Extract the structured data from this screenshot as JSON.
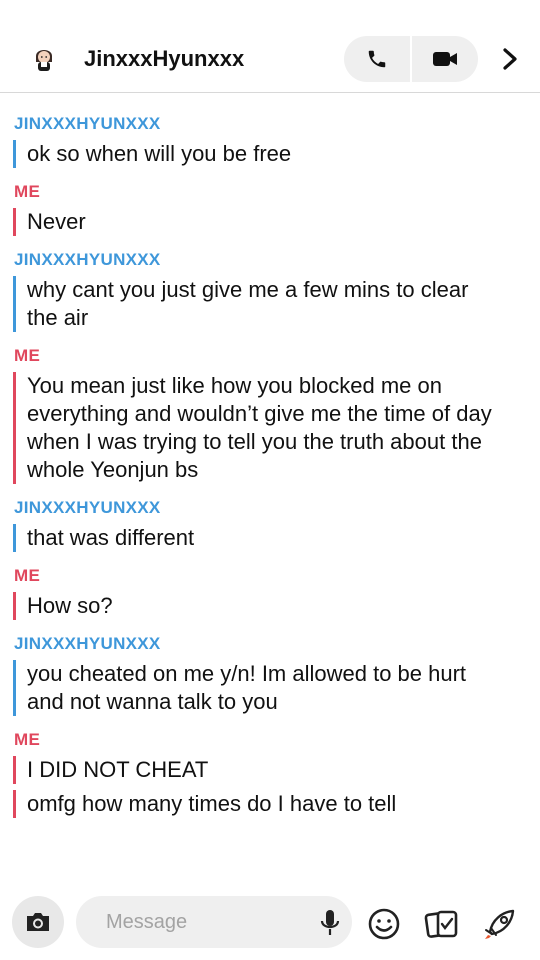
{
  "header": {
    "title": "JinxxxHyunxxx",
    "avatar_icon": "bitmoji-avatar-icon",
    "call_icons": [
      "phone-icon",
      "video-camera-icon"
    ],
    "more_icon": "chevron-right-icon"
  },
  "colors": {
    "them": "#3e97da",
    "me": "#e0475d"
  },
  "messages": [
    {
      "sender": "JINXXXHYUNXXX",
      "text": "ok so when will you be free"
    },
    {
      "sender": "ME",
      "text": "Never"
    },
    {
      "sender": "JINXXXHYUNXXX",
      "text": "why cant you just give me a few mins to clear the air"
    },
    {
      "sender": "ME",
      "text": "You mean just like how you blocked me on everything and wouldn’t give me the time of day when I was trying to tell you the truth about the whole Yeonjun bs"
    },
    {
      "sender": "JINXXXHYUNXXX",
      "text": "that was different"
    },
    {
      "sender": "ME",
      "text": "How so?"
    },
    {
      "sender": "JINXXXHYUNXXX",
      "text": "you cheated on me y/n! Im allowed to be hurt and not wanna talk to you"
    },
    {
      "sender": "ME",
      "text": "I DID NOT CHEAT"
    },
    {
      "sender": "ME",
      "text": "omfg how many times do I have to tell"
    }
  ],
  "input": {
    "placeholder": "Message",
    "value": ""
  },
  "bottom_icons": [
    "camera-icon",
    "microphone-icon",
    "smiley-icon",
    "stickers-icon",
    "rocket-icon"
  ]
}
